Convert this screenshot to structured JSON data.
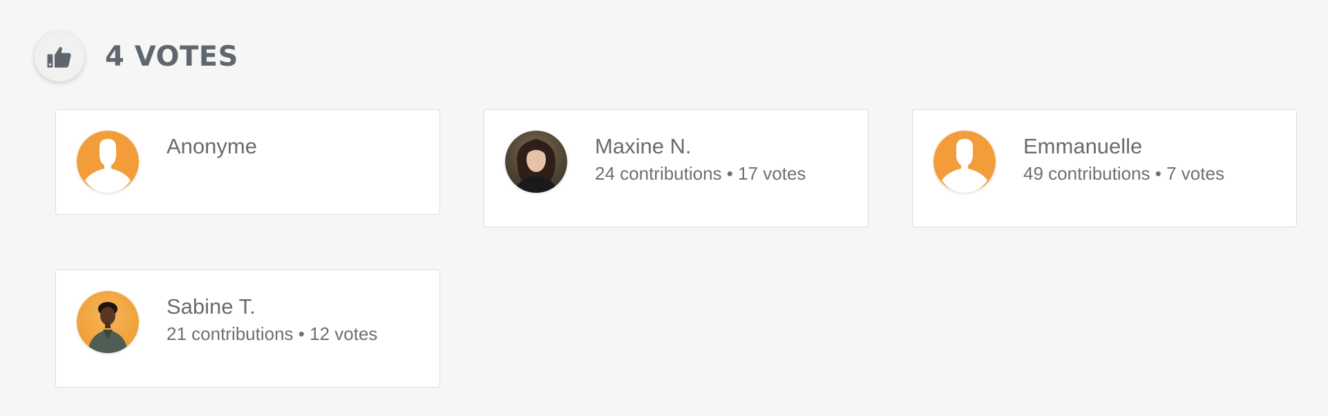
{
  "header": {
    "icon": "thumbs-up-icon",
    "title": "4 VOTES"
  },
  "voters": [
    {
      "name": "Anonyme",
      "avatar": "default-user-icon",
      "meta": ""
    },
    {
      "name": "Maxine N.",
      "avatar": "user-photo",
      "meta": "24 contributions • 17 votes"
    },
    {
      "name": "Emmanuelle",
      "avatar": "default-user-icon",
      "meta": "49 contributions • 7 votes"
    },
    {
      "name": "Sabine T.",
      "avatar": "user-photo",
      "meta": "21 contributions • 12 votes"
    }
  ],
  "colors": {
    "background": "#f6f6f6",
    "avatar_orange": "#f39d3a",
    "text": "#6b6b6b",
    "title": "#5f666d"
  }
}
